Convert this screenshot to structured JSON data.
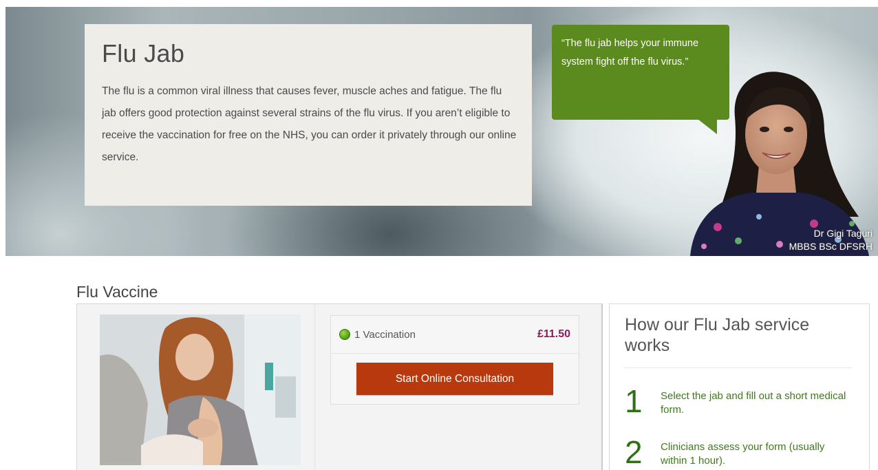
{
  "hero": {
    "title": "Flu Jab",
    "body": "The flu is a common viral illness that causes fever, muscle aches and fatigue. The flu jab offers good protection against several strains of the flu virus. If you aren’t eligible to receive the vaccination for free on the NHS, you can order it privately through our online service.",
    "quote": "“The flu jab helps your immune system fight off the flu virus.”",
    "doctor_name": "Dr Gigi Taguri",
    "doctor_credentials": "MBBS BSc DFSRH"
  },
  "section": {
    "title": "Flu Vaccine"
  },
  "product": {
    "option_label": "1 Vaccination",
    "option_price": "£11.50",
    "cta_label": "Start Online Consultation"
  },
  "how": {
    "title": "How our Flu Jab service works",
    "steps": [
      {
        "num": "1",
        "text": "Select the jab and fill out a short medical form."
      },
      {
        "num": "2",
        "text": "Clinicians assess your form (usually within 1 hour)."
      }
    ]
  },
  "colors": {
    "accent_green": "#5b8a1e",
    "cta_orange": "#b8390d",
    "price_purple": "#8b1c5e"
  }
}
